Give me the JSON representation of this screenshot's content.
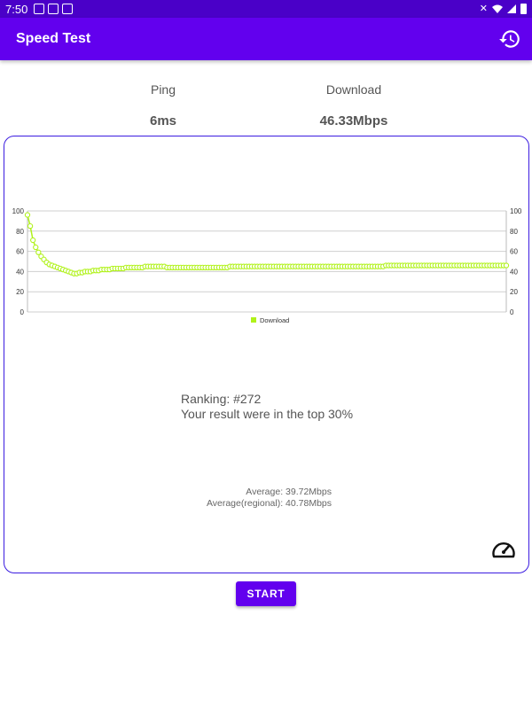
{
  "status_bar": {
    "time": "7:50",
    "icons": [
      "sim-icon",
      "image-icon",
      "close-box-icon",
      "mute-icon",
      "wifi-icon",
      "signal-icon",
      "battery-icon"
    ]
  },
  "app_bar": {
    "title": "Speed Test",
    "history_icon": "history-icon"
  },
  "stats": {
    "ping_label": "Ping",
    "ping_value": "6ms",
    "download_label": "Download",
    "download_value": "46.33Mbps"
  },
  "chart_data": {
    "type": "line",
    "series": [
      {
        "name": "Download",
        "color": "#b0f21a",
        "values": [
          96,
          85,
          71,
          64,
          59,
          55,
          52,
          49,
          47,
          46,
          45,
          44,
          43,
          42,
          41,
          40,
          39,
          38,
          38,
          39,
          39,
          40,
          40,
          40,
          41,
          41,
          41,
          42,
          42,
          42,
          42,
          43,
          43,
          43,
          43,
          43,
          44,
          44,
          44,
          44,
          44,
          44,
          44,
          45,
          45,
          45,
          45,
          45,
          45,
          45,
          45,
          44,
          44,
          44,
          44,
          44,
          44,
          44,
          44,
          44,
          44,
          44,
          44,
          44,
          44,
          44,
          44,
          44,
          44,
          44,
          44,
          44,
          44,
          44,
          45,
          45,
          45,
          45,
          45,
          45,
          45,
          45,
          45,
          45,
          45,
          45,
          45,
          45,
          45,
          45,
          45,
          45,
          45,
          45,
          45,
          45,
          45,
          45,
          45,
          45,
          45,
          45,
          45,
          45,
          45,
          45,
          45,
          45,
          45,
          45,
          45,
          45,
          45,
          45,
          45,
          45,
          45,
          45,
          45,
          45,
          45,
          45,
          45,
          45,
          45,
          45,
          45,
          45,
          45,
          45,
          45,
          46,
          46,
          46,
          46,
          46,
          46,
          46,
          46,
          46,
          46,
          46,
          46,
          46,
          46,
          46,
          46,
          46,
          46,
          46,
          46,
          46,
          46,
          46,
          46,
          46,
          46,
          46,
          46,
          46,
          46,
          46,
          46,
          46,
          46,
          46,
          46,
          46,
          46,
          46,
          46,
          46,
          46,
          46,
          46,
          46
        ]
      }
    ],
    "ylim": [
      0,
      100
    ],
    "yticks": [
      "0",
      "20",
      "40",
      "60",
      "80",
      "100"
    ],
    "y_right_axis": true,
    "grid": true,
    "legend_position": "bottom-center",
    "legend_label": "Download"
  },
  "ranking": {
    "line1": "Ranking: #272",
    "line2": "Your result were in the top 30%"
  },
  "averages": {
    "average": "Average: 39.72Mbps",
    "regional": "Average(regional): 40.78Mbps"
  },
  "gauge_icon": "speedometer-icon",
  "start_button": {
    "label": "START"
  },
  "colors": {
    "status_bar": "#4a00c8",
    "app_bar": "#6200ee",
    "card_border": "#3b1ce0",
    "series": "#b0f21a"
  }
}
